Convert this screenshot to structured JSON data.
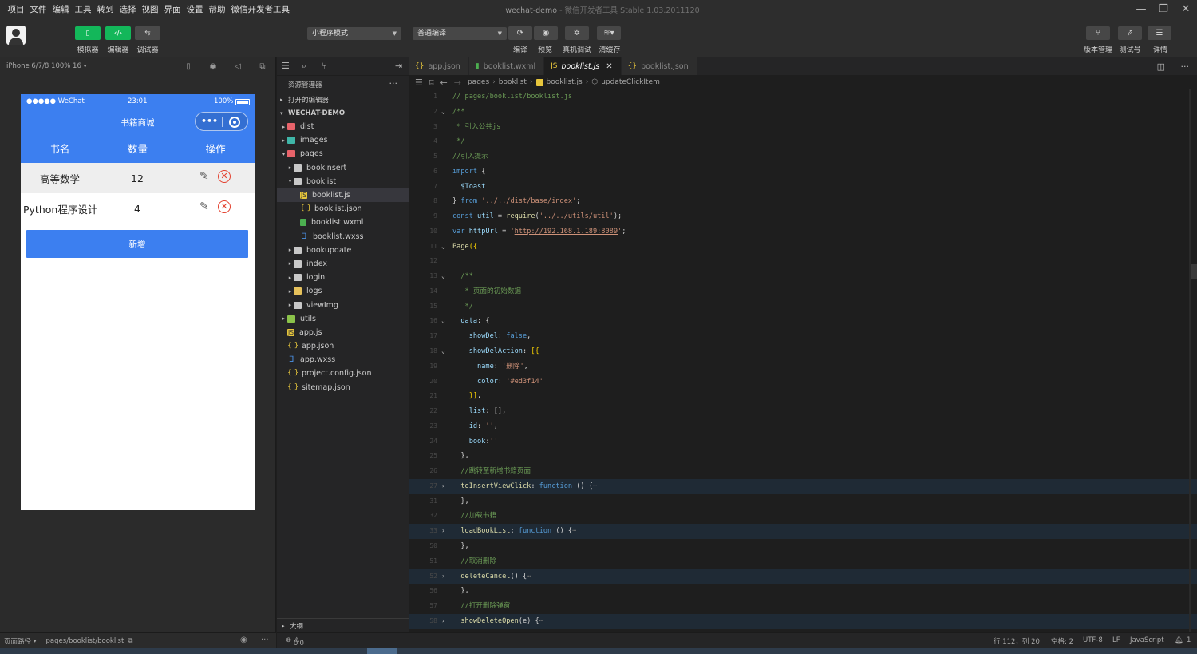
{
  "menubar": {
    "items": [
      "项目",
      "文件",
      "编辑",
      "工具",
      "转到",
      "选择",
      "视图",
      "界面",
      "设置",
      "帮助",
      "微信开发者工具"
    ],
    "title": "wechat-demo",
    "subtitle": " - 微信开发者工具 Stable 1.03.2011120"
  },
  "toolbar": {
    "simulator_label": "模拟器",
    "editor_label": "编辑器",
    "debugger_label": "调试器",
    "mode_select": "小程序模式",
    "compile_select": "普通编译",
    "compile_label": "编译",
    "preview_label": "预览",
    "real_debug_label": "真机调试",
    "clear_cache_label": "清缓存",
    "version_label": "版本管理",
    "test_label": "测试号",
    "details_label": "详情"
  },
  "simulator": {
    "device": "iPhone 6/7/8 100% 16",
    "status_left": "●●●●● WeChat",
    "status_time": "23:01",
    "status_battery": "100%",
    "nav_title": "书籍商城",
    "headers": [
      "书名",
      "数量",
      "操作"
    ],
    "rows": [
      {
        "name": "高等数学",
        "qty": "12"
      },
      {
        "name": "Python程序设计",
        "qty": "4"
      }
    ],
    "add_button": "新增"
  },
  "explorer": {
    "title": "资源管理器",
    "open_editors": "打开的编辑器",
    "project": "WECHAT-DEMO",
    "tree": [
      {
        "label": "dist",
        "depth": 1,
        "type": "folder-red",
        "arrow": "▸"
      },
      {
        "label": "images",
        "depth": 1,
        "type": "folder-teal",
        "arrow": "▸"
      },
      {
        "label": "pages",
        "depth": 1,
        "type": "folder-red",
        "arrow": "▾"
      },
      {
        "label": "bookinsert",
        "depth": 2,
        "type": "folder",
        "arrow": "▸"
      },
      {
        "label": "booklist",
        "depth": 2,
        "type": "folder",
        "arrow": "▾"
      },
      {
        "label": "booklist.js",
        "depth": 3,
        "type": "js",
        "arrow": "",
        "selected": true
      },
      {
        "label": "booklist.json",
        "depth": 3,
        "type": "json",
        "arrow": ""
      },
      {
        "label": "booklist.wxml",
        "depth": 3,
        "type": "wxml",
        "arrow": ""
      },
      {
        "label": "booklist.wxss",
        "depth": 3,
        "type": "wxss",
        "arrow": ""
      },
      {
        "label": "bookupdate",
        "depth": 2,
        "type": "folder",
        "arrow": "▸"
      },
      {
        "label": "index",
        "depth": 2,
        "type": "folder",
        "arrow": "▸"
      },
      {
        "label": "login",
        "depth": 2,
        "type": "folder",
        "arrow": "▸"
      },
      {
        "label": "logs",
        "depth": 2,
        "type": "folder-yel",
        "arrow": "▸"
      },
      {
        "label": "viewImg",
        "depth": 2,
        "type": "folder",
        "arrow": "▸"
      },
      {
        "label": "utils",
        "depth": 1,
        "type": "folder-green",
        "arrow": "▸"
      },
      {
        "label": "app.js",
        "depth": 1,
        "type": "js",
        "arrow": ""
      },
      {
        "label": "app.json",
        "depth": 1,
        "type": "json",
        "arrow": ""
      },
      {
        "label": "app.wxss",
        "depth": 1,
        "type": "wxss",
        "arrow": ""
      },
      {
        "label": "project.config.json",
        "depth": 1,
        "type": "json",
        "arrow": ""
      },
      {
        "label": "sitemap.json",
        "depth": 1,
        "type": "json",
        "arrow": ""
      }
    ],
    "outline": "大纲"
  },
  "tabs": [
    {
      "label": "app.json",
      "icon": "{}",
      "active": false
    },
    {
      "label": "booklist.wxml",
      "icon": "▮",
      "active": false
    },
    {
      "label": "booklist.js",
      "icon": "JS",
      "active": true
    },
    {
      "label": "booklist.json",
      "icon": "{}",
      "active": false
    }
  ],
  "breadcrumb": [
    "pages",
    "booklist",
    "booklist.js",
    "updateClickItem"
  ],
  "code": [
    {
      "n": "1",
      "f": "",
      "hl": false,
      "t": [
        [
          "c-com",
          "// pages/booklist/booklist.js"
        ]
      ]
    },
    {
      "n": "2",
      "f": "⌄",
      "hl": false,
      "t": [
        [
          "c-com",
          "/**"
        ]
      ]
    },
    {
      "n": "3",
      "f": "",
      "hl": false,
      "t": [
        [
          "c-com",
          " * 引入公共js"
        ]
      ]
    },
    {
      "n": "4",
      "f": "",
      "hl": false,
      "t": [
        [
          "c-com",
          " */"
        ]
      ]
    },
    {
      "n": "5",
      "f": "",
      "hl": false,
      "t": [
        [
          "c-com",
          "//引入提示"
        ]
      ]
    },
    {
      "n": "6",
      "f": "",
      "hl": false,
      "t": [
        [
          "c-kw",
          "import"
        ],
        [
          "c-plain",
          " {"
        ]
      ]
    },
    {
      "n": "7",
      "f": "",
      "hl": false,
      "t": [
        [
          "c-var",
          "  $Toast"
        ]
      ]
    },
    {
      "n": "8",
      "f": "",
      "hl": false,
      "t": [
        [
          "c-plain",
          "} "
        ],
        [
          "c-kw",
          "from"
        ],
        [
          "c-plain",
          " "
        ],
        [
          "c-str",
          "'../../dist/base/index'"
        ],
        [
          "c-plain",
          ";"
        ]
      ]
    },
    {
      "n": "9",
      "f": "",
      "hl": false,
      "t": [
        [
          "c-kw",
          "const"
        ],
        [
          "c-var",
          " util"
        ],
        [
          "c-plain",
          " = "
        ],
        [
          "c-fn",
          "require"
        ],
        [
          "c-plain",
          "("
        ],
        [
          "c-str",
          "'../../utils/util'"
        ],
        [
          "c-plain",
          ");"
        ]
      ]
    },
    {
      "n": "10",
      "f": "",
      "hl": false,
      "t": [
        [
          "c-kw",
          "var"
        ],
        [
          "c-var",
          " httpUrl"
        ],
        [
          "c-plain",
          " = "
        ],
        [
          "c-str",
          "'"
        ],
        [
          "c-url",
          "http://192.168.1.189:8089"
        ],
        [
          "c-str",
          "'"
        ],
        [
          "c-plain",
          ";"
        ]
      ]
    },
    {
      "n": "11",
      "f": "⌄",
      "hl": false,
      "t": [
        [
          "c-fn",
          "Page"
        ],
        [
          "c-br",
          "({"
        ]
      ]
    },
    {
      "n": "12",
      "f": "",
      "hl": false,
      "t": [
        [
          "c-plain",
          ""
        ]
      ]
    },
    {
      "n": "13",
      "f": "⌄",
      "hl": false,
      "t": [
        [
          "c-com",
          "  /**"
        ]
      ]
    },
    {
      "n": "14",
      "f": "",
      "hl": false,
      "t": [
        [
          "c-com",
          "   * 页面的初始数据"
        ]
      ]
    },
    {
      "n": "15",
      "f": "",
      "hl": false,
      "t": [
        [
          "c-com",
          "   */"
        ]
      ]
    },
    {
      "n": "16",
      "f": "⌄",
      "hl": false,
      "t": [
        [
          "c-key",
          "  data"
        ],
        [
          "c-plain",
          ": {"
        ]
      ]
    },
    {
      "n": "17",
      "f": "",
      "hl": false,
      "t": [
        [
          "c-key",
          "    showDel"
        ],
        [
          "c-plain",
          ": "
        ],
        [
          "c-bool",
          "false"
        ],
        [
          "c-plain",
          ","
        ]
      ]
    },
    {
      "n": "18",
      "f": "⌄",
      "hl": false,
      "t": [
        [
          "c-key",
          "    showDelAction"
        ],
        [
          "c-plain",
          ": "
        ],
        [
          "c-br",
          "[{"
        ]
      ]
    },
    {
      "n": "19",
      "f": "",
      "hl": false,
      "t": [
        [
          "c-key",
          "      name"
        ],
        [
          "c-plain",
          ": "
        ],
        [
          "c-str",
          "'删除'"
        ],
        [
          "c-plain",
          ","
        ]
      ]
    },
    {
      "n": "20",
      "f": "",
      "hl": false,
      "t": [
        [
          "c-key",
          "      color"
        ],
        [
          "c-plain",
          ": "
        ],
        [
          "c-str",
          "'#ed3f14'"
        ]
      ]
    },
    {
      "n": "21",
      "f": "",
      "hl": false,
      "t": [
        [
          "c-br",
          "    }]"
        ],
        [
          "c-plain",
          ","
        ]
      ]
    },
    {
      "n": "22",
      "f": "",
      "hl": false,
      "t": [
        [
          "c-key",
          "    list"
        ],
        [
          "c-plain",
          ": [],"
        ]
      ]
    },
    {
      "n": "23",
      "f": "",
      "hl": false,
      "t": [
        [
          "c-key",
          "    id"
        ],
        [
          "c-plain",
          ": "
        ],
        [
          "c-str",
          "''"
        ],
        [
          "c-plain",
          ","
        ]
      ]
    },
    {
      "n": "24",
      "f": "",
      "hl": false,
      "t": [
        [
          "c-key",
          "    book"
        ],
        [
          "c-plain",
          ":"
        ],
        [
          "c-str",
          "''"
        ]
      ]
    },
    {
      "n": "25",
      "f": "",
      "hl": false,
      "t": [
        [
          "c-plain",
          "  },"
        ]
      ]
    },
    {
      "n": "26",
      "f": "",
      "hl": false,
      "t": [
        [
          "c-com",
          "  //跳转至新增书籍页面"
        ]
      ]
    },
    {
      "n": "27",
      "f": "›",
      "hl": true,
      "t": [
        [
          "c-fn",
          "  toInsertViewClick"
        ],
        [
          "c-plain",
          ": "
        ],
        [
          "c-kw",
          "function"
        ],
        [
          "c-plain",
          " () {"
        ],
        [
          "c-dim",
          "⋯"
        ]
      ]
    },
    {
      "n": "31",
      "f": "",
      "hl": false,
      "t": [
        [
          "c-plain",
          "  },"
        ]
      ]
    },
    {
      "n": "32",
      "f": "",
      "hl": false,
      "t": [
        [
          "c-com",
          "  //加载书籍"
        ]
      ]
    },
    {
      "n": "33",
      "f": "›",
      "hl": true,
      "t": [
        [
          "c-fn",
          "  loadBookList"
        ],
        [
          "c-plain",
          ": "
        ],
        [
          "c-kw",
          "function"
        ],
        [
          "c-plain",
          " () {"
        ],
        [
          "c-dim",
          "⋯"
        ]
      ]
    },
    {
      "n": "50",
      "f": "",
      "hl": false,
      "t": [
        [
          "c-plain",
          "  },"
        ]
      ]
    },
    {
      "n": "51",
      "f": "",
      "hl": false,
      "t": [
        [
          "c-com",
          "  //取消删除"
        ]
      ]
    },
    {
      "n": "52",
      "f": "›",
      "hl": true,
      "t": [
        [
          "c-fn",
          "  deleteCancel"
        ],
        [
          "c-plain",
          "() {"
        ],
        [
          "c-dim",
          "⋯"
        ]
      ]
    },
    {
      "n": "56",
      "f": "",
      "hl": false,
      "t": [
        [
          "c-plain",
          "  },"
        ]
      ]
    },
    {
      "n": "57",
      "f": "",
      "hl": false,
      "t": [
        [
          "c-com",
          "  //打开删除弹窗"
        ]
      ]
    },
    {
      "n": "58",
      "f": "›",
      "hl": true,
      "t": [
        [
          "c-fn",
          "  showDeleteOpen"
        ],
        [
          "c-plain",
          "(e) {"
        ],
        [
          "c-dim",
          "⋯"
        ]
      ]
    }
  ],
  "status": {
    "page_path_label": "页面路径",
    "page_path": "pages/booklist/booklist",
    "problems": "0",
    "warnings": "0",
    "position": "行 112，列 20",
    "spaces": "空格: 2",
    "encoding": "UTF-8",
    "eol": "LF",
    "language": "JavaScript",
    "notifications": "1"
  }
}
